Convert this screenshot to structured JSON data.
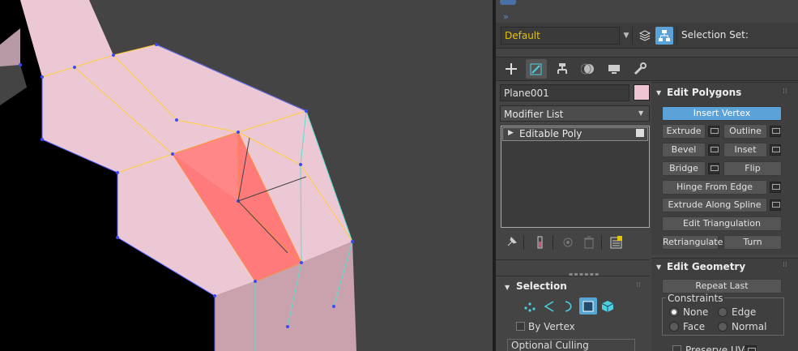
{
  "toolbar": {
    "layer_value": "Default",
    "selection_set_label": "Selection Set:"
  },
  "command_panel": {
    "tabs": [
      "create-icon",
      "modify-icon",
      "hierarchy-icon",
      "motion-icon",
      "display-icon",
      "utilities-icon"
    ],
    "active_tab": "modify-icon"
  },
  "object": {
    "name": "Plane001",
    "color": "#eec4d2"
  },
  "modifier_list": {
    "label": "Modifier List",
    "stack": [
      {
        "label": "Editable Poly"
      }
    ]
  },
  "selection_rollout": {
    "title": "Selection",
    "subobject_levels": [
      "vertex-icon",
      "edge-icon",
      "border-icon",
      "polygon-icon",
      "element-icon"
    ],
    "active_level": "polygon-icon",
    "by_vertex_label": "By Vertex",
    "optional_culling_label": "Optional Culling"
  },
  "edit_polygons": {
    "title": "Edit Polygons",
    "insert_vertex": "Insert Vertex",
    "extrude": "Extrude",
    "outline": "Outline",
    "bevel": "Bevel",
    "inset": "Inset",
    "bridge": "Bridge",
    "flip": "Flip",
    "hinge_from_edge": "Hinge From Edge",
    "extrude_along_spline": "Extrude Along Spline",
    "edit_triangulation": "Edit Triangulation",
    "retriangulate": "Retriangulate",
    "turn": "Turn"
  },
  "edit_geometry": {
    "title": "Edit Geometry",
    "repeat_last": "Repeat Last",
    "constraints_label": "Constraints",
    "constraints": [
      {
        "label": "None",
        "selected": true
      },
      {
        "label": "Edge",
        "selected": false
      },
      {
        "label": "Face",
        "selected": false
      },
      {
        "label": "Normal",
        "selected": false
      }
    ],
    "preserve_uvs_label": "Preserve UVs"
  },
  "colors": {
    "accent": "#5ba2d8",
    "layer_text": "#e8c400",
    "mesh_face": "#eec4d2",
    "selected_face": "#ff7b7b"
  }
}
